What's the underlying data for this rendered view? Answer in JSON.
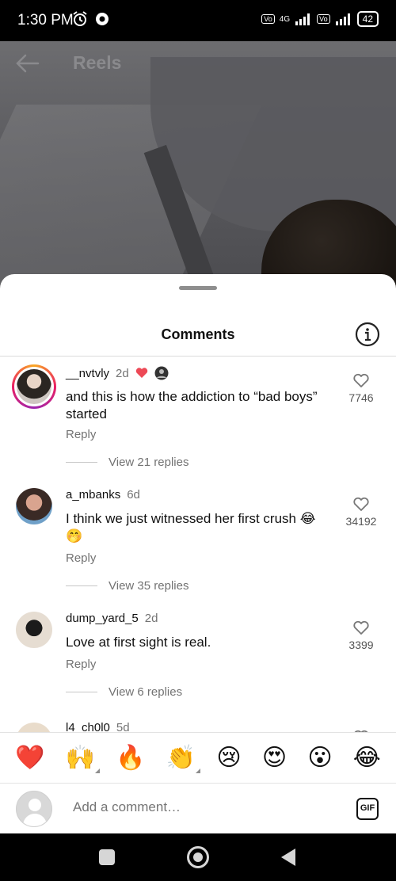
{
  "status_bar": {
    "time": "1:30 PM",
    "network_label": "4G",
    "battery": "42"
  },
  "header": {
    "title": "Reels"
  },
  "sheet": {
    "title": "Comments"
  },
  "comments": [
    {
      "username": "__nvtvly",
      "time": "2d",
      "text": "and this is how the addiction to “bad boys” started",
      "reply_label": "Reply",
      "likes": "7746",
      "view_replies": "View 21 replies"
    },
    {
      "username": "a_mbanks",
      "time": "6d",
      "text": "I think we just witnessed her first crush 😂🤭",
      "reply_label": "Reply",
      "likes": "34192",
      "view_replies": "View 35 replies"
    },
    {
      "username": "dump_yard_5",
      "time": "2d",
      "text": "Love at first sight is real.",
      "reply_label": "Reply",
      "likes": "3399",
      "view_replies": "View 6 replies"
    },
    {
      "username": "l4_ch0l0",
      "time": "5d"
    }
  ],
  "emoji_bar": [
    "❤️",
    "🙌",
    "🔥",
    "👏",
    "😢",
    "😍",
    "😮",
    "😂"
  ],
  "input": {
    "placeholder": "Add a comment…",
    "gif_label": "GIF"
  },
  "colors": {
    "like_heart": "#ed4956",
    "muted": "#737373"
  }
}
